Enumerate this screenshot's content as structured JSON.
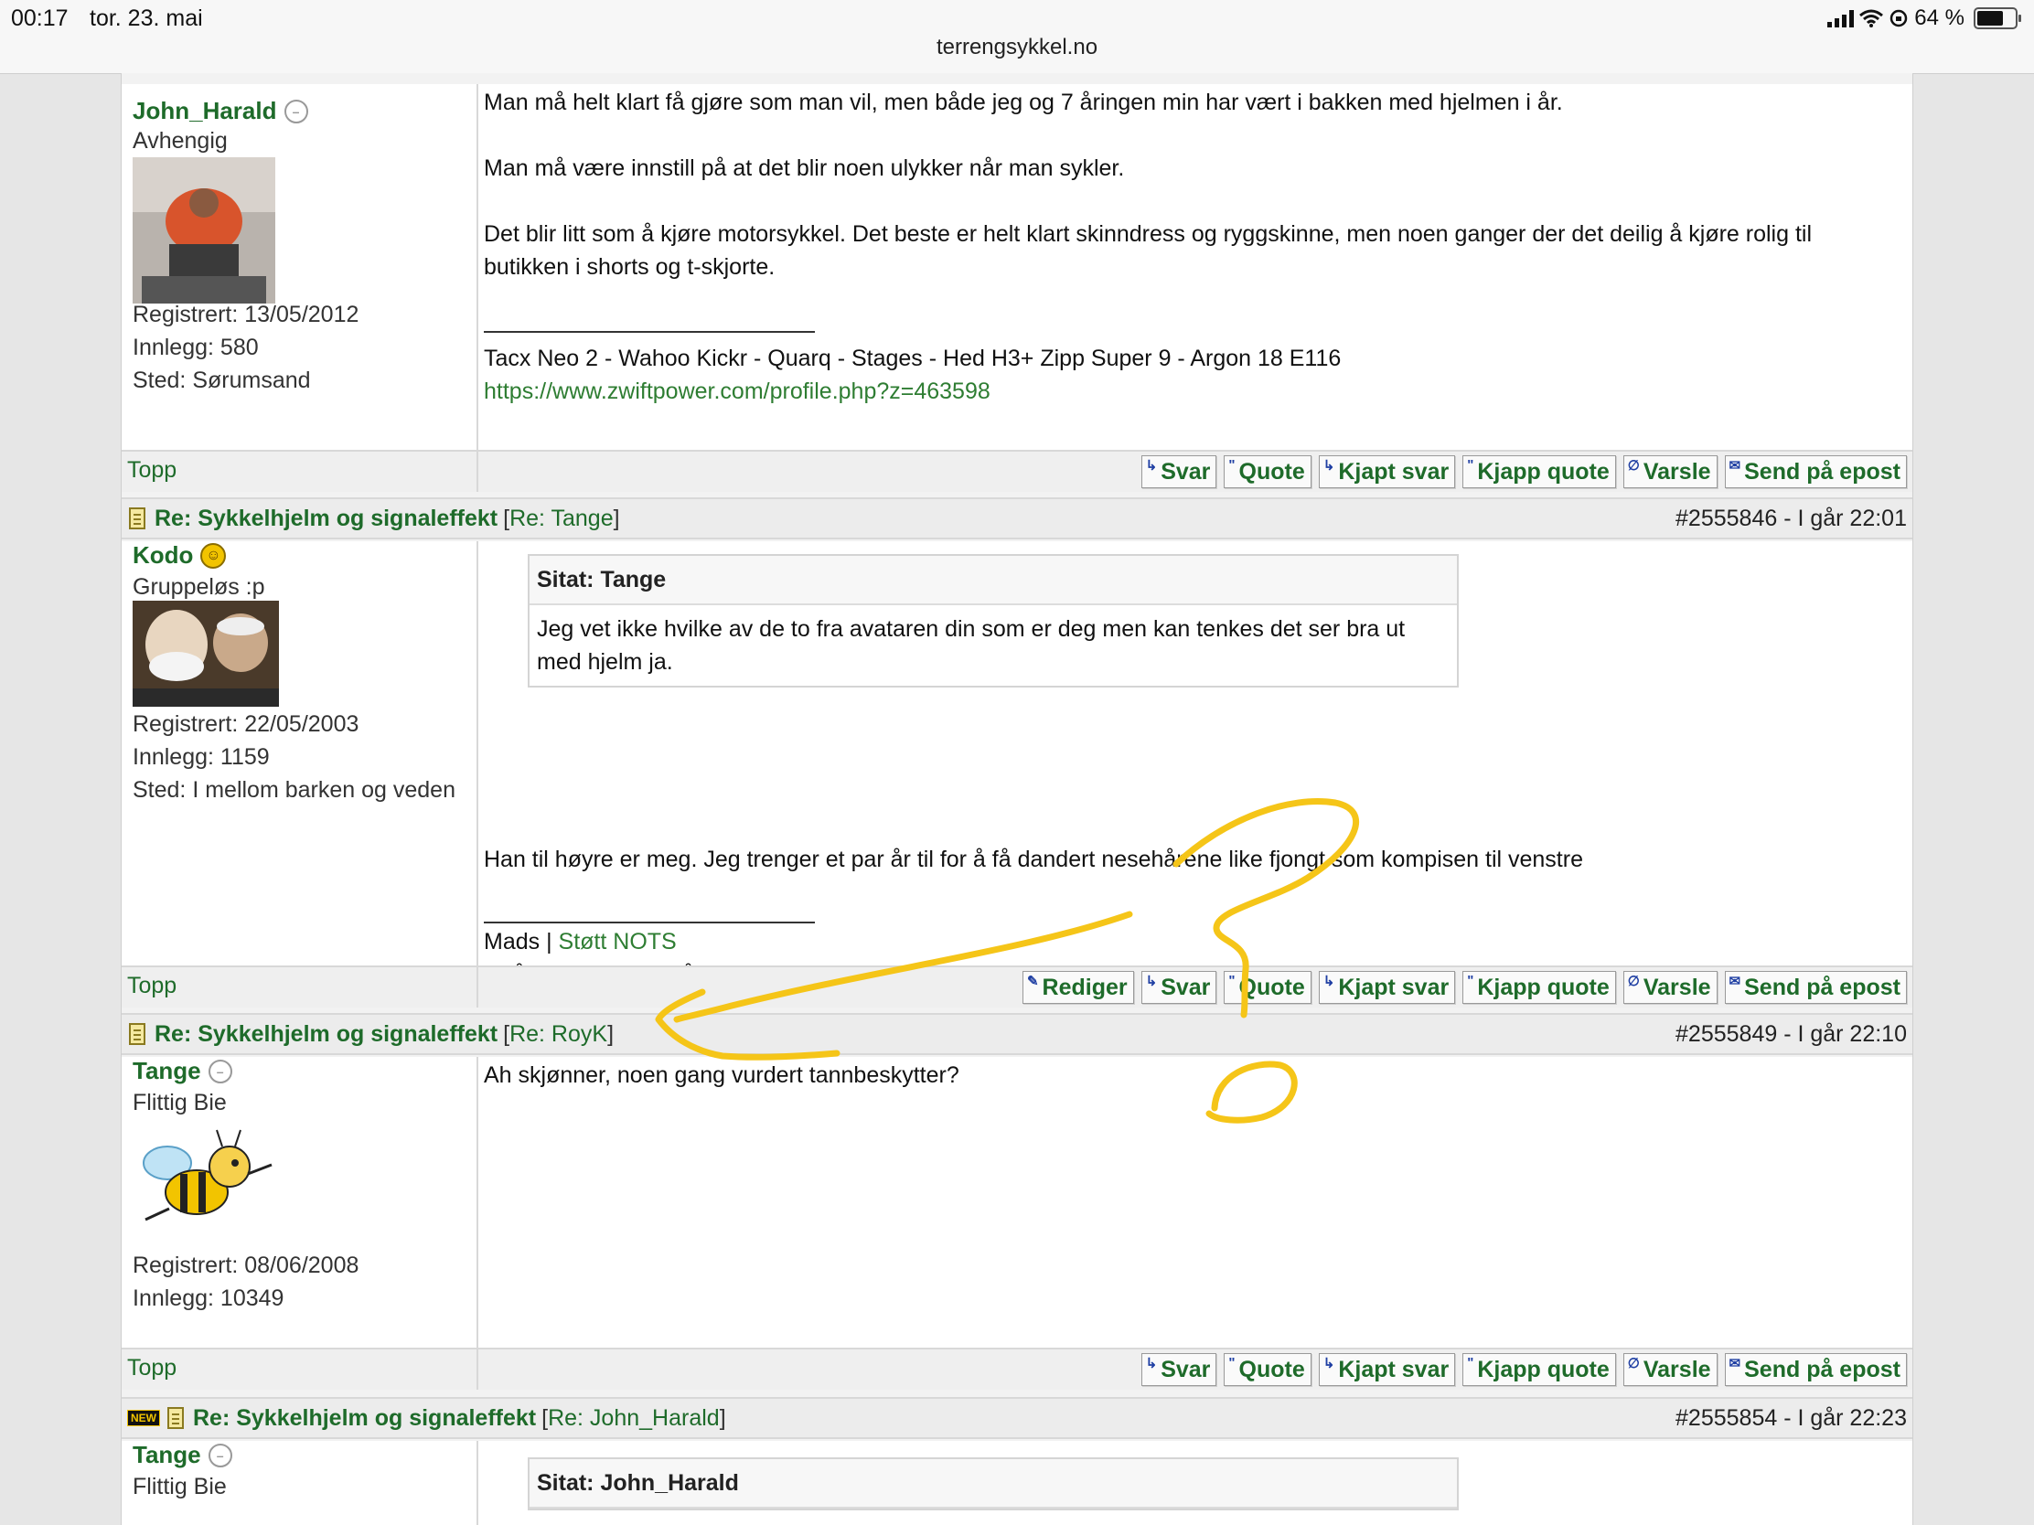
{
  "status_bar": {
    "time": "00:17",
    "date": "tor. 23. mai",
    "url": "terrengsykkel.no",
    "battery": "64 %",
    "battery_level": 0.64
  },
  "common": {
    "topp": "Topp",
    "buttons": {
      "rediger": "Rediger",
      "svar": "Svar",
      "quote": "Quote",
      "kjapt_svar": "Kjapt svar",
      "kjapp_quote": "Kjapp quote",
      "varsle": "Varsle",
      "send_epost": "Send på epost"
    },
    "colors": {
      "link_green": "#1e6b2a",
      "annotation_yellow": "#f5c518"
    }
  },
  "posts": [
    {
      "user": {
        "name": "John_Harald",
        "rank": "Avhengig",
        "registered": "Registrert: 13/05/2012",
        "posts": "Innlegg: 580",
        "location": "Sted: Sørumsand"
      },
      "body": {
        "p1": "Man må helt klart få gjøre som man vil, men både jeg og 7 åringen min har vært i bakken med hjelmen i år.",
        "p2": "Man må være innstill på at det blir noen ulykker når man sykler.",
        "p3a": "Det blir litt som å kjøre motorsykkel. Det beste er helt klart skinndress og ryggskinne, men noen ganger der det deilig å kjøre rolig til",
        "p3b": "butikken i shorts og t-skjorte.",
        "sig1": "Tacx Neo 2 - Wahoo Kickr - Quarq - Stages - Hed H3+ Zipp Super 9 - Argon 18 E116",
        "sig_link": "https://www.zwiftpower.com/profile.php?z=463598"
      }
    },
    {
      "header": {
        "title": "Re: Sykkelhjelm og signaleffekt",
        "re_open": "[",
        "re": "Re: Tange",
        "re_close": "]",
        "id_time": "#2555846 - I går 22:01"
      },
      "user": {
        "name": "Kodo",
        "rank": "Gruppeløs :p",
        "registered": "Registrert: 22/05/2003",
        "posts": "Innlegg: 1159",
        "location": "Sted: I mellom barken og veden"
      },
      "quote": {
        "head": "Sitat: Tange",
        "line1": "Jeg vet ikke hvilke av de to fra avataren din som er deg men kan tenkes det ser bra ut",
        "line2": "med hjelm ja."
      },
      "body": {
        "p1": "Han til høyre er meg. Jeg trenger et par år til for å få dandert nesehårene like fjongt som kompisen til venstre",
        "sig_name": "Mads | ",
        "sig_link": "Støtt NOTS",
        "sig2": "- Så mange deler, så lite penger"
      }
    },
    {
      "header": {
        "title": "Re: Sykkelhjelm og signaleffekt",
        "re_open": "[",
        "re": "Re: RoyK",
        "re_close": "]",
        "id_time": "#2555849 - I går 22:10"
      },
      "user": {
        "name": "Tange",
        "rank": "Flittig Bie",
        "registered": "Registrert: 08/06/2008",
        "posts": "Innlegg: 10349"
      },
      "body": {
        "p1": "Ah skjønner, noen gang vurdert tannbeskytter?"
      }
    },
    {
      "header": {
        "new_badge": "NEW",
        "title": "Re: Sykkelhjelm og signaleffekt",
        "re_open": "[",
        "re": "Re: John_Harald",
        "re_close": "]",
        "id_time": "#2555854 - I går 22:23"
      },
      "user": {
        "name": "Tange",
        "rank": "Flittig Bie"
      },
      "quote": {
        "head": "Sitat: John_Harald"
      }
    }
  ]
}
